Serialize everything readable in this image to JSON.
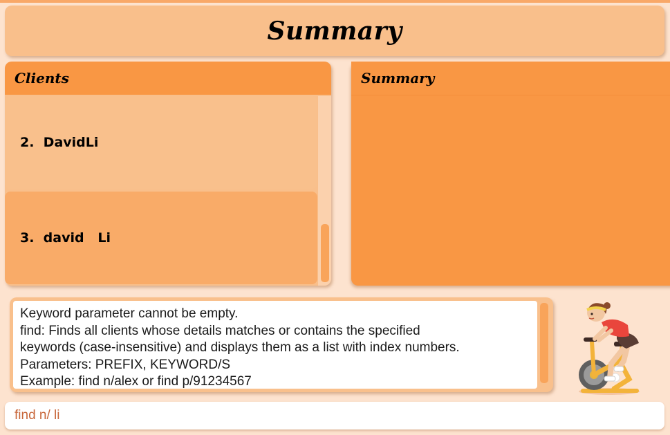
{
  "header": {
    "title": "Summary"
  },
  "clients_panel": {
    "title": "Clients",
    "items": [
      {
        "label": "2.  DavidLi"
      },
      {
        "label": "3.  david   Li"
      }
    ]
  },
  "summary_panel": {
    "title": "Summary"
  },
  "result_display": {
    "lines": [
      "Keyword parameter cannot be empty.",
      "find: Finds all clients whose details matches or contains the specified",
      "keywords (case-insensitive) and displays them as a list with index numbers.",
      "Parameters: PREFIX, KEYWORD/S",
      "Example: find n/alex or find p/91234567"
    ]
  },
  "command_box": {
    "value": "find n/ li"
  },
  "mascot": {
    "icon": "cyclist-mascot-icon"
  },
  "colors": {
    "background": "#fde3cf",
    "panel_light": "#f9bf8b",
    "panel_dark": "#f99744",
    "card_alt": "#f9ab68"
  }
}
